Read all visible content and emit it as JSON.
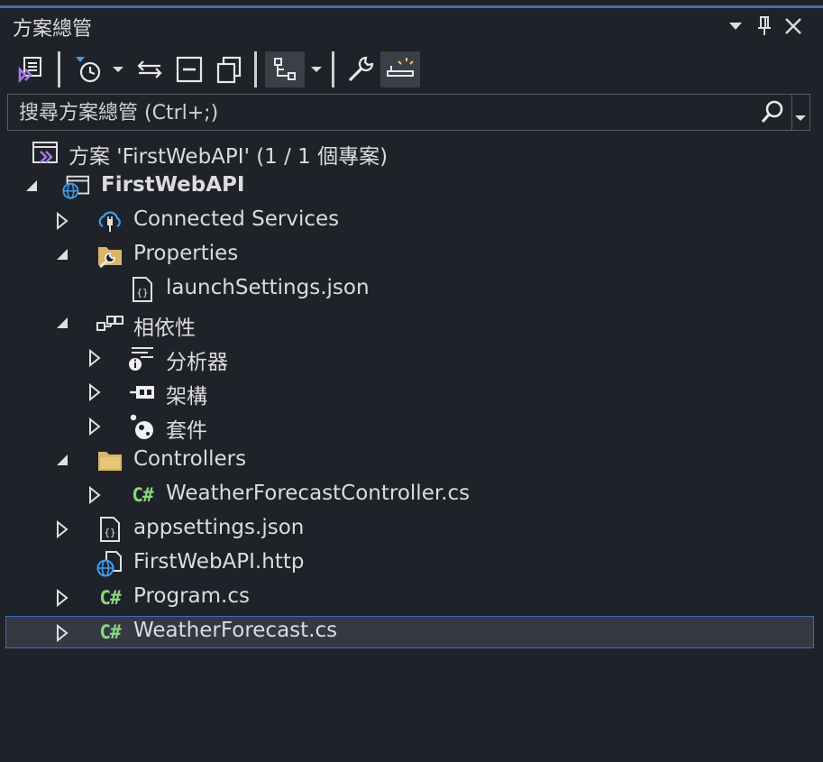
{
  "panel": {
    "title": "方案總管",
    "accent_color": "#3e6fb6",
    "background": "#1f2229",
    "controls": [
      "dropdown-icon",
      "pin-icon",
      "close-icon"
    ]
  },
  "toolbar": {
    "buttons": [
      {
        "name": "switch-views-icon"
      },
      {
        "name": "pending-changes-filter-icon"
      },
      {
        "name": "pending-changes-dropdown-icon"
      },
      {
        "name": "sync-with-active-document-icon"
      },
      {
        "name": "collapse-all-icon"
      },
      {
        "name": "show-all-files-icon"
      },
      {
        "name": "view-class-diagram-icon",
        "active": true
      },
      {
        "name": "view-dropdown-icon"
      },
      {
        "name": "properties-wrench-icon"
      },
      {
        "name": "preview-selected-items-icon",
        "active": true
      }
    ]
  },
  "search": {
    "placeholder": "搜尋方案總管 (Ctrl+;)",
    "value": ""
  },
  "tree": {
    "solution": {
      "label": "方案 'FirstWebAPI' (1 / 1 個專案)"
    },
    "project": {
      "label": "FirstWebAPI",
      "expanded": true
    },
    "items": {
      "connected_services": {
        "label": "Connected Services",
        "expanded": false
      },
      "properties": {
        "label": "Properties",
        "expanded": true
      },
      "launch_settings": {
        "label": "launchSettings.json"
      },
      "dependencies": {
        "label": "相依性",
        "expanded": true
      },
      "analyzers": {
        "label": "分析器",
        "expanded": false
      },
      "frameworks": {
        "label": "架構",
        "expanded": false
      },
      "packages": {
        "label": "套件",
        "expanded": false
      },
      "controllers": {
        "label": "Controllers",
        "expanded": true
      },
      "weather_controller": {
        "label": "WeatherForecastController.cs",
        "expanded": false
      },
      "appsettings": {
        "label": "appsettings.json",
        "expanded": false
      },
      "http_file": {
        "label": "FirstWebAPI.http"
      },
      "program": {
        "label": "Program.cs",
        "expanded": false
      },
      "weather_forecast": {
        "label": "WeatherForecast.cs",
        "expanded": false,
        "selected": true
      }
    },
    "csharp_glyph": "C#"
  }
}
